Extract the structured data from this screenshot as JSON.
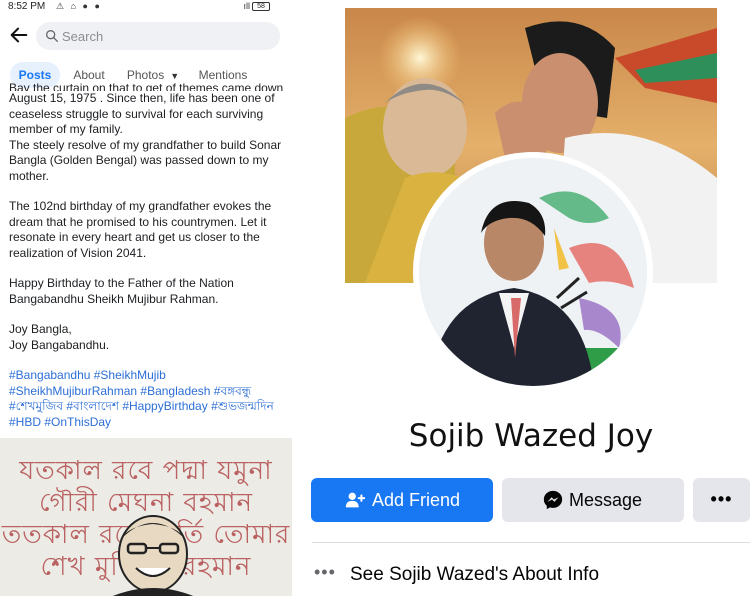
{
  "status_bar": {
    "time": "8:52 PM",
    "battery": "58"
  },
  "left": {
    "search": {
      "placeholder": "Search"
    },
    "tabs": [
      {
        "label": "Posts",
        "active": true
      },
      {
        "label": "About",
        "active": false
      },
      {
        "label": "Photos",
        "active": false
      },
      {
        "label": "Mentions",
        "active": false
      }
    ],
    "post": {
      "cut_line": "Bay the curtain on that to get of themes came down on",
      "para1": "August 15, 1975 . Since then, life has been one of ceaseless struggle to survival  for each surviving member of my family.",
      "para2": "The steely resolve of my grandfather to build Sonar Bangla (Golden Bengal) was passed down to my mother.",
      "para3": "The 102nd birthday of my grandfather evokes the dream that he promised  to his countrymen. Let it resonate in every heart and get us closer to the realization of Vision 2041.",
      "para4": "Happy Birthday to the Father of the Nation Bangabandhu Sheikh Mujibur Rahman.",
      "para5": "Joy Bangla,\nJoy Bangabandhu.",
      "hashtags": "#Bangabandhu #SheikhMujib #SheikhMujiburRahman #Bangladesh #বঙ্গবন্ধু #শেখমুজিব #বাংলাদেশ #HappyBirthday #শুভজন্মদিন #HBD #OnThisDay"
    },
    "artwork_lines": [
      "যতকাল রবে পদ্মা যমুনা",
      "গৌরী মেঘনা বহমান",
      "ততকাল রবে কীর্তি তোমার",
      "শেখ মুজিবুর রহমান"
    ]
  },
  "profile": {
    "name": "Sojib Wazed Joy",
    "add_friend": "Add Friend",
    "message": "Message",
    "more": "•••",
    "about": "See Sojib Wazed's About Info",
    "about_dots": "•••"
  },
  "colors": {
    "brand_blue": "#1877f2",
    "secondary_button": "#e4e6eb",
    "hashtag": "#2d6fd6"
  },
  "icons": [
    "back-arrow-icon",
    "search-icon",
    "add-friend-icon",
    "messenger-icon",
    "more-icon"
  ]
}
